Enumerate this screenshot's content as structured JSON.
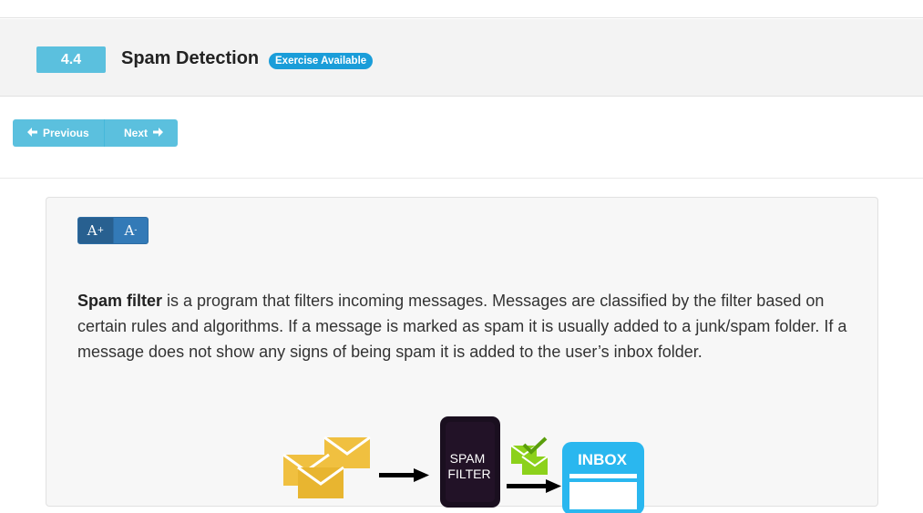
{
  "header": {
    "section_number": "4.4",
    "title": "Spam Detection",
    "badge": "Exercise Available"
  },
  "nav": {
    "previous_label": "Previous",
    "next_label": "Next"
  },
  "font_controls": {
    "increase_label": "A",
    "increase_sup": "+",
    "decrease_label": "A",
    "decrease_sup": "-"
  },
  "content": {
    "term": "Spam filter",
    "text": " is a program that filters incoming messages. Messages are classified by the filter based on certain rules and algorithms. If a message is marked as spam it is usually added to a junk/spam folder. If a message does not show any signs of being spam it is added to the user’s inbox folder."
  },
  "diagram": {
    "filter_label_line1": "SPAM",
    "filter_label_line2": "FILTER",
    "inbox_label": "INBOX",
    "colors": {
      "envelope": "#f0c040",
      "filter": "#1a0f1f",
      "checkmark": "#8cd11b",
      "inbox": "#2ab7ef"
    }
  }
}
